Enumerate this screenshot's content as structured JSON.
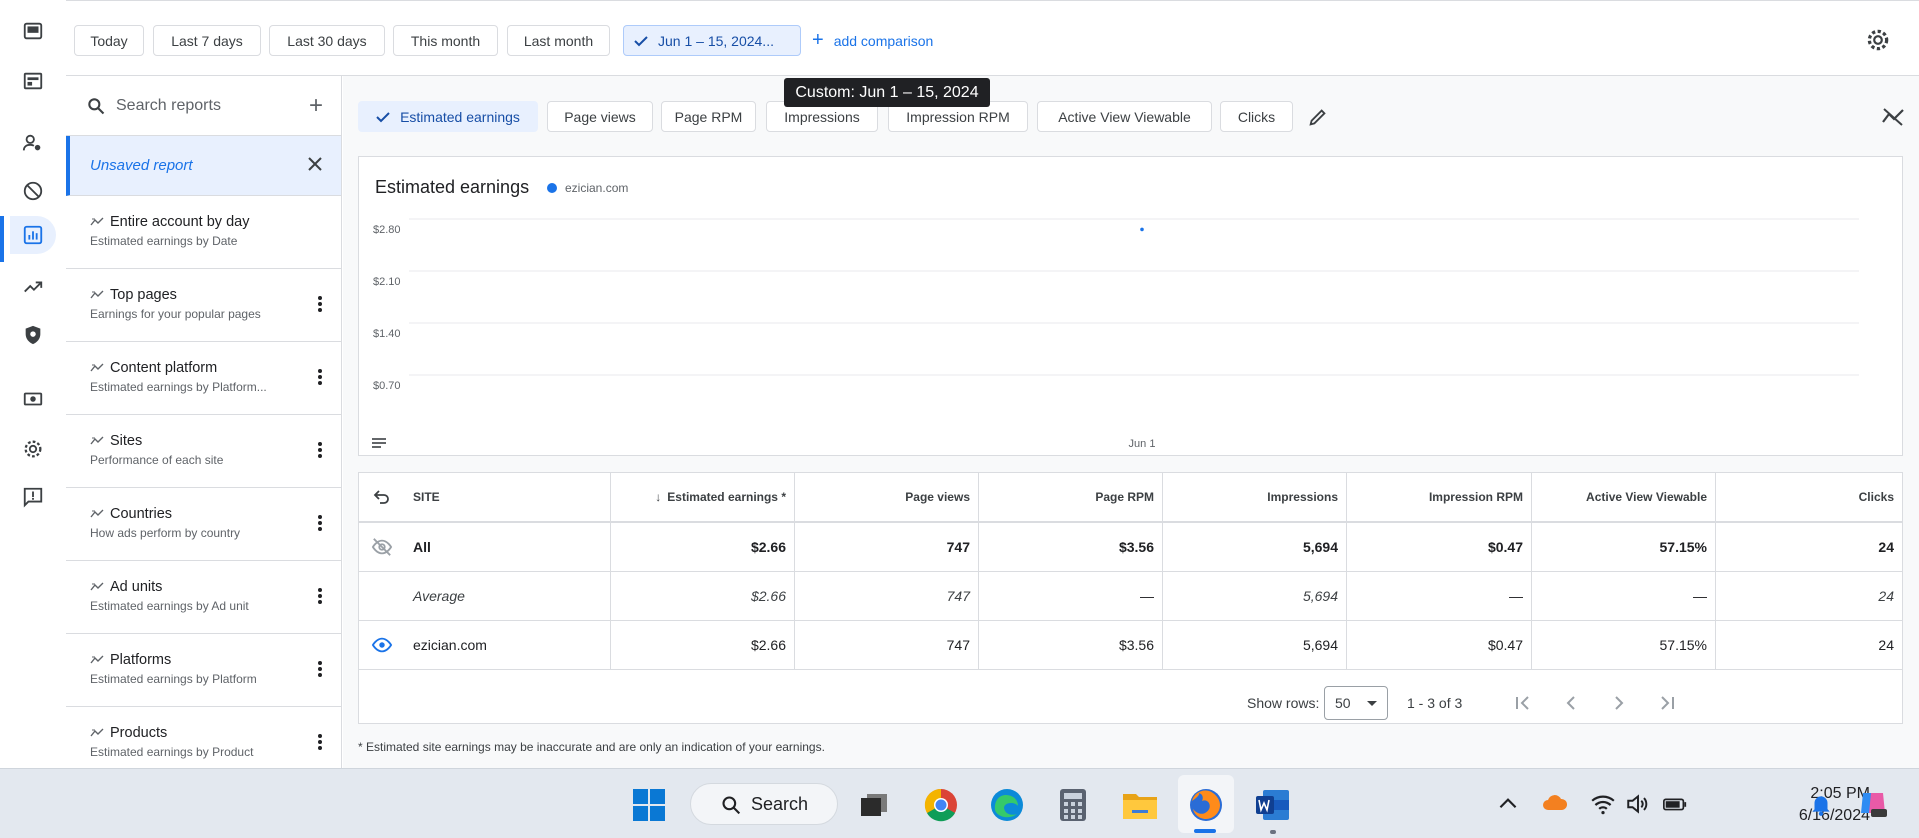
{
  "date_filters": {
    "today": "Today",
    "last7": "Last 7 days",
    "last30": "Last 30 days",
    "this_month": "This month",
    "last_month": "Last month",
    "custom": "Jun 1 – 15, 2024...",
    "add_comparison": "add comparison"
  },
  "tooltip": "Custom: Jun 1 – 15, 2024",
  "sidebar": {
    "search_placeholder": "Search reports",
    "unsaved": "Unsaved report",
    "reports": [
      {
        "title": "Entire account by day",
        "subtitle": "Estimated earnings by Date"
      },
      {
        "title": "Top pages",
        "subtitle": "Earnings for your popular pages"
      },
      {
        "title": "Content platform",
        "subtitle": "Estimated earnings by Platform..."
      },
      {
        "title": "Sites",
        "subtitle": "Performance of each site"
      },
      {
        "title": "Countries",
        "subtitle": "How ads perform by country"
      },
      {
        "title": "Ad units",
        "subtitle": "Estimated earnings by Ad unit"
      },
      {
        "title": "Platforms",
        "subtitle": "Estimated earnings by Platform"
      },
      {
        "title": "Products",
        "subtitle": "Estimated earnings by Product"
      }
    ]
  },
  "metrics": {
    "earnings": "Estimated earnings",
    "page_views": "Page views",
    "page_rpm": "Page RPM",
    "impressions": "Impressions",
    "impression_rpm": "Impression RPM",
    "active_view": "Active View Viewable",
    "clicks": "Clicks"
  },
  "chart_data": {
    "type": "scatter",
    "title": "Estimated earnings",
    "legend": [
      "ezician.com"
    ],
    "y_ticks": [
      "$2.80",
      "$2.10",
      "$1.40",
      "$0.70"
    ],
    "x_ticks": [
      "Jun 1"
    ],
    "ylim": [
      0,
      3.5
    ],
    "series": [
      {
        "name": "ezician.com",
        "x": [
          "Jun 1"
        ],
        "values": [
          2.66
        ]
      }
    ],
    "grid": true,
    "colors": {
      "ezician.com": "#1a73e8"
    }
  },
  "table": {
    "headers": {
      "site": "SITE",
      "earnings": "Estimated earnings *",
      "page_views": "Page views",
      "page_rpm": "Page RPM",
      "impressions": "Impressions",
      "impression_rpm": "Impression RPM",
      "active_view": "Active View Viewable",
      "clicks": "Clicks"
    },
    "all": {
      "site": "All",
      "earnings": "$2.66",
      "page_views": "747",
      "page_rpm": "$3.56",
      "impressions": "5,694",
      "impression_rpm": "$0.47",
      "active_view": "57.15%",
      "clicks": "24"
    },
    "average": {
      "site": "Average",
      "earnings": "$2.66",
      "page_views": "747",
      "page_rpm": "—",
      "impressions": "5,694",
      "impression_rpm": "—",
      "active_view": "—",
      "clicks": "24"
    },
    "site_row": {
      "site": "ezician.com",
      "earnings": "$2.66",
      "page_views": "747",
      "page_rpm": "$3.56",
      "impressions": "5,694",
      "impression_rpm": "$0.47",
      "active_view": "57.15%",
      "clicks": "24"
    }
  },
  "pager": {
    "show_rows_label": "Show rows:",
    "rows_value": "50",
    "range": "1 - 3 of 3"
  },
  "footnote": "* Estimated site earnings may be inaccurate and are only an indication of your earnings.",
  "taskbar": {
    "search": "Search",
    "time": "2:05 PM",
    "date": "6/16/2024"
  }
}
